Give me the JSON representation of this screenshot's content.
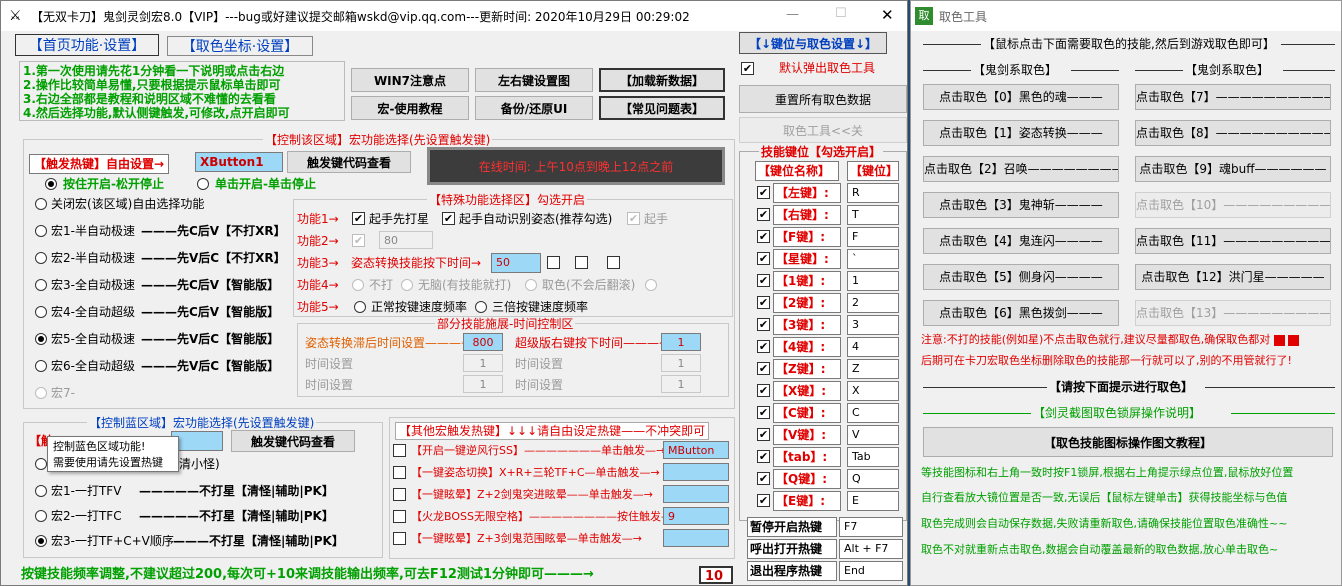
{
  "main": {
    "title": "【无双卡刀】鬼剑灵剑宏8.0【VIP】---bug或好建议提交邮箱wskd@vip.qq.com---更新时间: 2020年10月29日 00:29:02",
    "win_controls": [
      "—",
      "☐",
      "✕"
    ],
    "tabs": [
      "【首页功能·设置】",
      "【取色坐标·设置】"
    ],
    "intro": [
      "1.第一次使用请先花1分钟看一下说明或点击右边",
      "2.操作比较简单易懂,只要根据提示鼠标单击即可",
      "3.右边全部都是教程和说明区域不难懂的去看看",
      "4.然后选择功能,默认侧键触发,可修改,点开启即可"
    ],
    "top_buttons": [
      "WIN7注意点",
      "左右键设置图",
      "【加载新数据】",
      "宏-使用教程",
      "备份/还原UI",
      "【常见问题表】"
    ],
    "ctrl_group": {
      "title": "【控制该区域】宏功能选择(先设置触发键)",
      "hotkey_label": "【触发热键】自由设置→",
      "hotkey_value": "XButton1",
      "code_btn": "触发键代码查看",
      "online_time": "在线时间: 上午10点到晚上12点之前",
      "mode_hold": "按住开启-松开停止",
      "mode_click": "单击开启-单击停止",
      "macros": [
        {
          "name": "关闭宏(该区域)自由选择功能",
          "desc": ""
        },
        {
          "name": "宏1-半自动极速",
          "desc": "———先C后V【不打XR】"
        },
        {
          "name": "宏2-半自动极速",
          "desc": "———先V后C【不打XR】"
        },
        {
          "name": "宏3-全自动极速",
          "desc": "———先C后V【智能版】"
        },
        {
          "name": "宏4-全自动超级",
          "desc": "———先C后V【智能版】"
        },
        {
          "name": "宏5-全自动极速",
          "desc": "———先V后C【智能版】"
        },
        {
          "name": "宏6-全自动超级",
          "desc": "———先V后C【智能版】"
        },
        {
          "name": "宏7-",
          "desc": ""
        }
      ]
    },
    "special": {
      "title": "【特殊功能选择区】勾选开启",
      "f1_label": "功能1→",
      "f1_a": "起手先打星",
      "f1_b": "起手自动识别姿态(推荐勾选)",
      "f1_c": "起手",
      "f2_label": "功能2→",
      "f2_value": "80",
      "f3_label": "功能3→",
      "f3_text": "姿态转换技能按下时间→",
      "f3_value": "50",
      "f4_label": "功能4→",
      "f4_a": "不打",
      "f4_b": "无脑(有技能就打)",
      "f4_c": "取色(不会后翻滚)",
      "f5_label": "功能5→",
      "f5_a": "正常按键速度频率",
      "f5_b": "三倍按键速度频率"
    },
    "timing": {
      "title": "部分技能施展-时间控制区",
      "rows": [
        {
          "l1": "姿态转换滞后时间设置———→",
          "v1": "800",
          "l2": "超级版右键按下时间———→",
          "v2": "1"
        },
        {
          "l1": "时间设置",
          "v1": "1",
          "l2": "时间设置",
          "v2": "1"
        },
        {
          "l1": "时间设置",
          "v1": "1",
          "l2": "时间设置",
          "v2": "1"
        }
      ]
    },
    "ctrl_blue": {
      "title": "【控制蓝区域】宏功能选择(先设置触发键)",
      "hotkey_label": "【触",
      "code_btn": "触发键代码查看",
      "tooltip1": "控制蓝色区域功能!",
      "tooltip2": "需要使用请先设置热键",
      "close_suffix": "清小怪)",
      "macros": [
        {
          "name": "宏1-一打TFV",
          "desc": "—————不打星【清怪|辅助|PK】"
        },
        {
          "name": "宏2-一打TFC",
          "desc": "—————不打星【清怪|辅助|PK】"
        },
        {
          "name": "宏3-一打TF+C+V顺序",
          "desc": "———不打星【清怪|辅助|PK】"
        }
      ]
    },
    "other_hotkeys": {
      "title": "【其他宏触发热键】↓↓↓请自由设定热键——不冲突即可",
      "rows": [
        {
          "label": "【开启一键逆风行SS】———————单击触发—→",
          "value": "MButton"
        },
        {
          "label": "【一键姿态切换】X+R+三轮TF+C—单击触发—→",
          "value": ""
        },
        {
          "label": "【一键眩晕】Z+2剑鬼突进眩晕——单击触发—→",
          "value": ""
        },
        {
          "label": "【火龙BOSS无限空格】————————按住触发—→",
          "value": "9"
        },
        {
          "label": "【一键眩晕】Z+3剑鬼范围眩晕—单击触发—→",
          "value": ""
        }
      ]
    },
    "bottom_text": "按键技能频率调整,不建议超过200,每次可+10来调技能输出频率,可去F12测试1分钟即可———→",
    "bottom_value": "10",
    "right_panel": {
      "header": "【↓键位与取色设置↓】",
      "popup_label": "默认弹出取色工具",
      "reset_btn": "重置所有取色数据",
      "close_tool": "取色工具<<关",
      "table_title": "技能键位【勾选开启】",
      "col1": "【键位名称】",
      "col2": "【键位】",
      "rows": [
        {
          "name": "【左键】:",
          "key": "R"
        },
        {
          "name": "【右键】:",
          "key": "T"
        },
        {
          "name": "【F键】:",
          "key": "F"
        },
        {
          "name": "【星键】:",
          "key": "`"
        },
        {
          "name": "【1键】:",
          "key": "1"
        },
        {
          "name": "【2键】:",
          "key": "2"
        },
        {
          "name": "【3键】:",
          "key": "3"
        },
        {
          "name": "【4键】:",
          "key": "4"
        },
        {
          "name": "【Z键】:",
          "key": "Z"
        },
        {
          "name": "【X键】:",
          "key": "X"
        },
        {
          "name": "【C键】:",
          "key": "C"
        },
        {
          "name": "【V键】:",
          "key": "V"
        },
        {
          "name": "【tab】:",
          "key": "Tab"
        },
        {
          "name": "【Q键】:",
          "key": "Q"
        },
        {
          "name": "【E键】:",
          "key": "E"
        }
      ],
      "hotkeys": [
        {
          "label": "暂停开启热键",
          "value": "F7"
        },
        {
          "label": "呼出打开热键",
          "value": "Alt + F7"
        },
        {
          "label": "退出程序热键",
          "value": "End"
        }
      ]
    }
  },
  "picker": {
    "icon": "取",
    "title": "取色工具",
    "header": "【鼠标点击下面需要取色的技能,然后到游戏取色即可】",
    "col_left": "【鬼剑系取色】",
    "col_right": "【鬼剑系取色】",
    "left_buttons": [
      "点击取色【0】黑色的魂———",
      "点击取色【1】姿态转换———",
      "点击取色【2】召唤————————",
      "点击取色【3】鬼神斩————",
      "点击取色【4】鬼连闪————",
      "点击取色【5】侧身闪————",
      "点击取色【6】黑色拨剑———"
    ],
    "right_buttons": [
      "点击取色【7】——————————",
      "点击取色【8】——————————",
      "点击取色【9】魂buff——————",
      "点击取色【10】——————————",
      "点击取色【11】——————————",
      "点击取色【12】洪门星—————",
      "点击取色【13】——————————"
    ],
    "note1": "注意:不打的技能(例如星)不点击取色就行,建议尽量都取色,确保取色都对",
    "note2": "后期可在卡刀宏取色坐标删除取色的技能那一行就可以了,别的不用管就行了!",
    "prompt": "【请按下面提示进行取色】",
    "guide_title": "【剑灵截图取色锁屏操作说明】",
    "guide_btn": "【取色技能图标操作图文教程】",
    "guide": [
      "等技能图标和右上角一致时按F1锁屏,根据右上角提示绿点位置,鼠标放好位置",
      "自行查看放大镜位置是否一致,无误后【鼠标左键单击】获得技能坐标与色值",
      "取色完成则会自动保存数据,失败请重新取色,请确保技能位置取色准确性~~",
      "取色不对就重新点击取色,数据会自动覆盖最新的取色数据,放心单击取色~"
    ],
    "accent_red": "#e00000",
    "accent_green": "#00a000",
    "bar_color": "#9ed8f7"
  }
}
